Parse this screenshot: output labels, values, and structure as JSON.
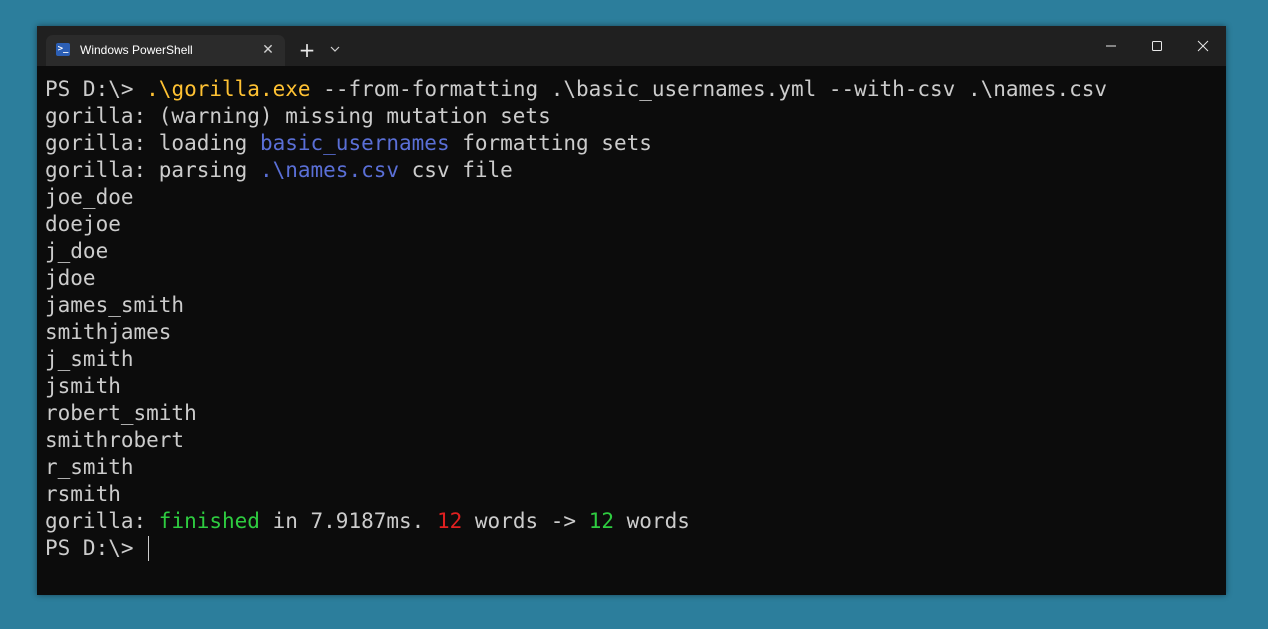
{
  "window": {
    "tab_title": "Windows PowerShell",
    "tab_icon": "powershell-icon",
    "close_tab_symbol": "✕",
    "new_tab_symbol": "+"
  },
  "terminal": {
    "command": {
      "prompt": "PS D:\\> ",
      "executable": ".\\gorilla.exe",
      "args": " --from-formatting .\\basic_usernames.yml --with-csv .\\names.csv"
    },
    "warning_line": "gorilla: (warning) missing mutation sets",
    "loading_line": {
      "prefix": "gorilla: loading ",
      "highlight": "basic_usernames",
      "suffix": " formatting sets"
    },
    "parsing_line": {
      "prefix": "gorilla: parsing ",
      "highlight": ".\\names.csv",
      "suffix": " csv file"
    },
    "outputs": [
      "joe_doe",
      "doejoe",
      "j_doe",
      "jdoe",
      "james_smith",
      "smithjames",
      "j_smith",
      "jsmith",
      "robert_smith",
      "smithrobert",
      "r_smith",
      "rsmith"
    ],
    "summary": {
      "prefix": "gorilla: ",
      "finished": "finished",
      "time_text": " in 7.9187ms. ",
      "in_count": "12",
      "middle": " words -> ",
      "out_count": "12",
      "suffix": " words"
    },
    "final_prompt": "PS D:\\> "
  },
  "colors": {
    "background": "#2c7e9c",
    "terminal_bg": "#0c0c0c",
    "titlebar_bg": "#202020",
    "text": "#cccccc",
    "command_exe": "#ffc233",
    "highlight_blue": "#5a6fd6",
    "success_green": "#2ecc40",
    "count_red": "#e02020"
  }
}
